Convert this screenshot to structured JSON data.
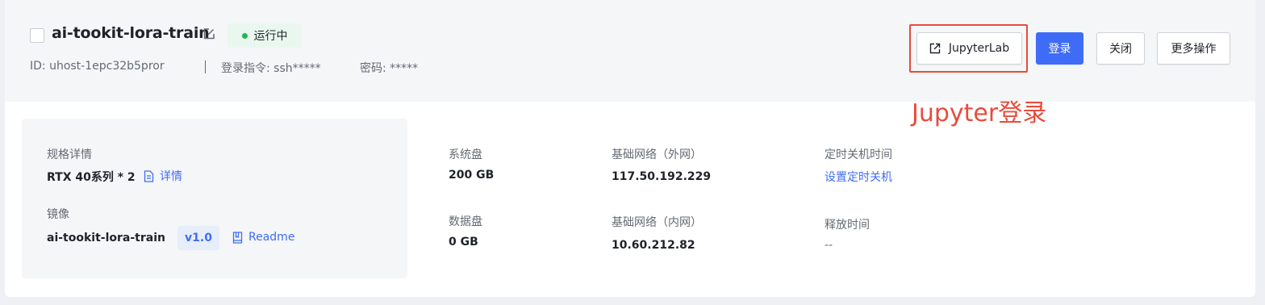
{
  "instance": {
    "name": "ai-tookit-lora-train",
    "status": "运行中",
    "id_text": "ID: uhost-1epc32b5pror",
    "login_cmd_text": "登录指令: ssh*****",
    "password_text": "密码: *****"
  },
  "actions": {
    "jupyterlab": "JupyterLab",
    "login": "登录",
    "close": "关闭",
    "more": "更多操作"
  },
  "annotation": "Jupyter登录",
  "spec": {
    "spec_label": "规格详情",
    "spec_value": "RTX 40系列 * 2",
    "detail_link": "详情",
    "image_label": "镜像",
    "image_value": "ai-tookit-lora-train",
    "image_version": "v1.0",
    "readme_link": "Readme"
  },
  "disks": {
    "system_label": "系统盘",
    "system_value": "200 GB",
    "data_label": "数据盘",
    "data_value": "0 GB"
  },
  "network": {
    "public_label": "基础网络（外网）",
    "public_value": "117.50.192.229",
    "private_label": "基础网络（内网）",
    "private_value": "10.60.212.82"
  },
  "schedule": {
    "shutdown_label": "定时关机时间",
    "shutdown_link": "设置定时关机",
    "release_label": "释放时间",
    "release_value": "--"
  },
  "colors": {
    "accent": "#3f6cf6",
    "status_green": "#1fb65b",
    "annotation_red": "#e74c3c"
  }
}
